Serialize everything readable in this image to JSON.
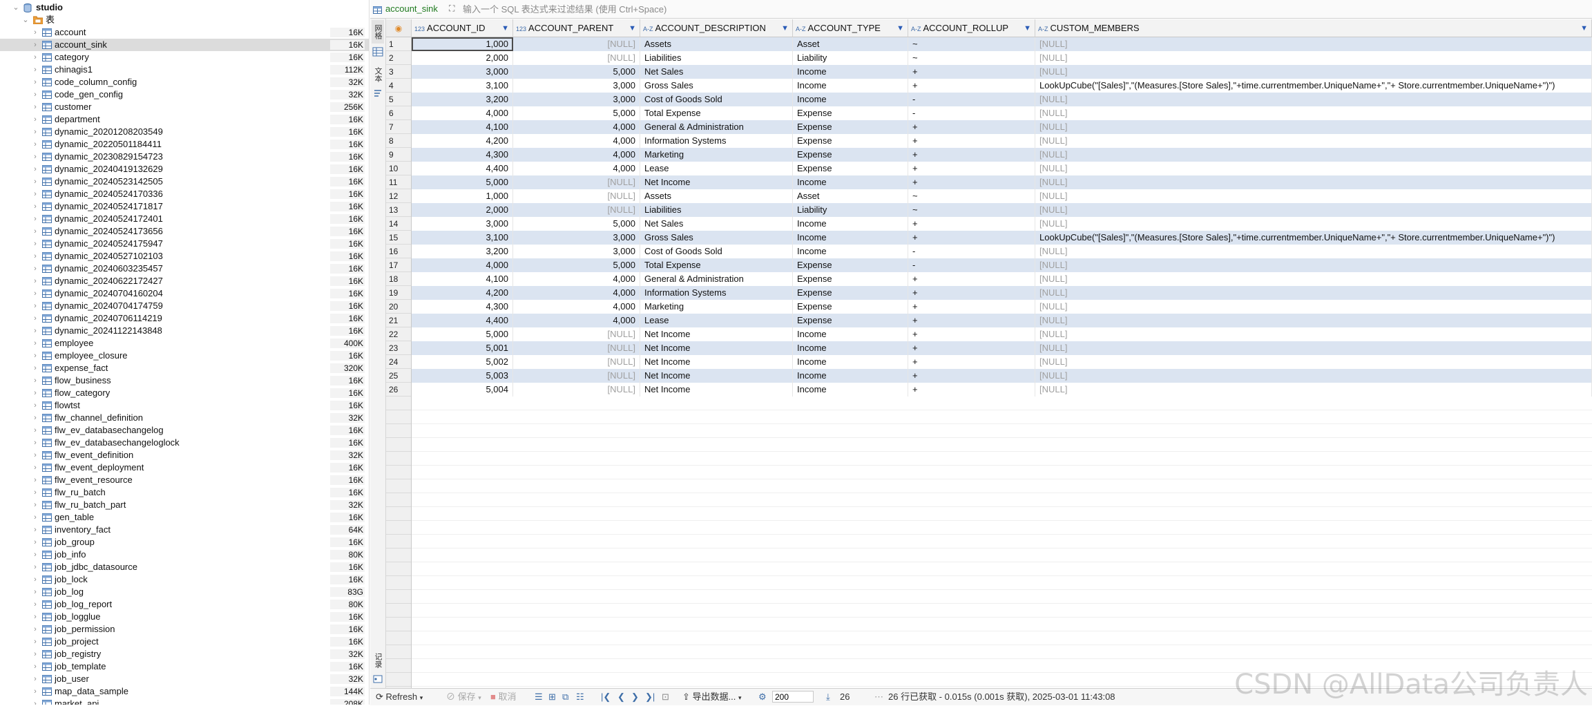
{
  "navigator": {
    "database": "studio",
    "folder": "表",
    "tables": [
      {
        "name": "account",
        "size": "16K"
      },
      {
        "name": "account_sink",
        "size": "16K",
        "selected": true
      },
      {
        "name": "category",
        "size": "16K"
      },
      {
        "name": "chinagis1",
        "size": "112K"
      },
      {
        "name": "code_column_config",
        "size": "32K"
      },
      {
        "name": "code_gen_config",
        "size": "32K"
      },
      {
        "name": "customer",
        "size": "256K"
      },
      {
        "name": "department",
        "size": "16K"
      },
      {
        "name": "dynamic_20201208203549",
        "size": "16K"
      },
      {
        "name": "dynamic_20220501184411",
        "size": "16K"
      },
      {
        "name": "dynamic_20230829154723",
        "size": "16K"
      },
      {
        "name": "dynamic_20240419132629",
        "size": "16K"
      },
      {
        "name": "dynamic_20240523142505",
        "size": "16K"
      },
      {
        "name": "dynamic_20240524170336",
        "size": "16K"
      },
      {
        "name": "dynamic_20240524171817",
        "size": "16K"
      },
      {
        "name": "dynamic_20240524172401",
        "size": "16K"
      },
      {
        "name": "dynamic_20240524173656",
        "size": "16K"
      },
      {
        "name": "dynamic_20240524175947",
        "size": "16K"
      },
      {
        "name": "dynamic_20240527102103",
        "size": "16K"
      },
      {
        "name": "dynamic_20240603235457",
        "size": "16K"
      },
      {
        "name": "dynamic_20240622172427",
        "size": "16K"
      },
      {
        "name": "dynamic_20240704160204",
        "size": "16K"
      },
      {
        "name": "dynamic_20240704174759",
        "size": "16K"
      },
      {
        "name": "dynamic_20240706114219",
        "size": "16K"
      },
      {
        "name": "dynamic_20241122143848",
        "size": "16K"
      },
      {
        "name": "employee",
        "size": "400K"
      },
      {
        "name": "employee_closure",
        "size": "16K"
      },
      {
        "name": "expense_fact",
        "size": "320K"
      },
      {
        "name": "flow_business",
        "size": "16K"
      },
      {
        "name": "flow_category",
        "size": "16K"
      },
      {
        "name": "flowtst",
        "size": "16K"
      },
      {
        "name": "flw_channel_definition",
        "size": "32K"
      },
      {
        "name": "flw_ev_databasechangelog",
        "size": "16K"
      },
      {
        "name": "flw_ev_databasechangeloglock",
        "size": "16K"
      },
      {
        "name": "flw_event_definition",
        "size": "32K"
      },
      {
        "name": "flw_event_deployment",
        "size": "16K"
      },
      {
        "name": "flw_event_resource",
        "size": "16K"
      },
      {
        "name": "flw_ru_batch",
        "size": "16K"
      },
      {
        "name": "flw_ru_batch_part",
        "size": "32K"
      },
      {
        "name": "gen_table",
        "size": "16K"
      },
      {
        "name": "inventory_fact",
        "size": "64K"
      },
      {
        "name": "job_group",
        "size": "16K"
      },
      {
        "name": "job_info",
        "size": "80K"
      },
      {
        "name": "job_jdbc_datasource",
        "size": "16K"
      },
      {
        "name": "job_lock",
        "size": "16K"
      },
      {
        "name": "job_log",
        "size": "83G"
      },
      {
        "name": "job_log_report",
        "size": "80K"
      },
      {
        "name": "job_logglue",
        "size": "16K"
      },
      {
        "name": "job_permission",
        "size": "16K"
      },
      {
        "name": "job_project",
        "size": "16K"
      },
      {
        "name": "job_registry",
        "size": "32K"
      },
      {
        "name": "job_template",
        "size": "16K"
      },
      {
        "name": "job_user",
        "size": "32K"
      },
      {
        "name": "map_data_sample",
        "size": "144K"
      },
      {
        "name": "market_api",
        "size": "208K"
      }
    ]
  },
  "editor": {
    "tab_label": "account_sink",
    "filter_placeholder": "输入一个 SQL 表达式来过滤结果 (使用 Ctrl+Space)",
    "side_tabs": {
      "grid": "网格",
      "text": "文本",
      "record": "记录"
    }
  },
  "grid": {
    "columns": [
      {
        "name": "ACCOUNT_ID",
        "type": "123"
      },
      {
        "name": "ACCOUNT_PARENT",
        "type": "123"
      },
      {
        "name": "ACCOUNT_DESCRIPTION",
        "type": "A-Z"
      },
      {
        "name": "ACCOUNT_TYPE",
        "type": "A-Z"
      },
      {
        "name": "ACCOUNT_ROLLUP",
        "type": "A-Z"
      },
      {
        "name": "CUSTOM_MEMBERS",
        "type": "A-Z"
      }
    ],
    "rows": [
      [
        "1",
        "1,000",
        "[NULL]",
        "Assets",
        "Asset",
        "~",
        "[NULL]"
      ],
      [
        "2",
        "2,000",
        "[NULL]",
        "Liabilities",
        "Liability",
        "~",
        "[NULL]"
      ],
      [
        "3",
        "3,000",
        "5,000",
        "Net Sales",
        "Income",
        "+",
        "[NULL]"
      ],
      [
        "4",
        "3,100",
        "3,000",
        "Gross Sales",
        "Income",
        "+",
        "LookUpCube(\"[Sales]\",\"(Measures.[Store Sales],\"+time.currentmember.UniqueName+\",\"+ Store.currentmember.UniqueName+\")\")"
      ],
      [
        "5",
        "3,200",
        "3,000",
        "Cost of Goods Sold",
        "Income",
        "-",
        "[NULL]"
      ],
      [
        "6",
        "4,000",
        "5,000",
        "Total Expense",
        "Expense",
        "-",
        "[NULL]"
      ],
      [
        "7",
        "4,100",
        "4,000",
        "General & Administration",
        "Expense",
        "+",
        "[NULL]"
      ],
      [
        "8",
        "4,200",
        "4,000",
        "Information Systems",
        "Expense",
        "+",
        "[NULL]"
      ],
      [
        "9",
        "4,300",
        "4,000",
        "Marketing",
        "Expense",
        "+",
        "[NULL]"
      ],
      [
        "10",
        "4,400",
        "4,000",
        "Lease",
        "Expense",
        "+",
        "[NULL]"
      ],
      [
        "11",
        "5,000",
        "[NULL]",
        "Net Income",
        "Income",
        "+",
        "[NULL]"
      ],
      [
        "12",
        "1,000",
        "[NULL]",
        "Assets",
        "Asset",
        "~",
        "[NULL]"
      ],
      [
        "13",
        "2,000",
        "[NULL]",
        "Liabilities",
        "Liability",
        "~",
        "[NULL]"
      ],
      [
        "14",
        "3,000",
        "5,000",
        "Net Sales",
        "Income",
        "+",
        "[NULL]"
      ],
      [
        "15",
        "3,100",
        "3,000",
        "Gross Sales",
        "Income",
        "+",
        "LookUpCube(\"[Sales]\",\"(Measures.[Store Sales],\"+time.currentmember.UniqueName+\",\"+ Store.currentmember.UniqueName+\")\")"
      ],
      [
        "16",
        "3,200",
        "3,000",
        "Cost of Goods Sold",
        "Income",
        "-",
        "[NULL]"
      ],
      [
        "17",
        "4,000",
        "5,000",
        "Total Expense",
        "Expense",
        "-",
        "[NULL]"
      ],
      [
        "18",
        "4,100",
        "4,000",
        "General & Administration",
        "Expense",
        "+",
        "[NULL]"
      ],
      [
        "19",
        "4,200",
        "4,000",
        "Information Systems",
        "Expense",
        "+",
        "[NULL]"
      ],
      [
        "20",
        "4,300",
        "4,000",
        "Marketing",
        "Expense",
        "+",
        "[NULL]"
      ],
      [
        "21",
        "4,400",
        "4,000",
        "Lease",
        "Expense",
        "+",
        "[NULL]"
      ],
      [
        "22",
        "5,000",
        "[NULL]",
        "Net Income",
        "Income",
        "+",
        "[NULL]"
      ],
      [
        "23",
        "5,001",
        "[NULL]",
        "Net Income",
        "Income",
        "+",
        "[NULL]"
      ],
      [
        "24",
        "5,002",
        "[NULL]",
        "Net Income",
        "Income",
        "+",
        "[NULL]"
      ],
      [
        "25",
        "5,003",
        "[NULL]",
        "Net Income",
        "Income",
        "+",
        "[NULL]"
      ],
      [
        "26",
        "5,004",
        "[NULL]",
        "Net Income",
        "Income",
        "+",
        "[NULL]"
      ]
    ]
  },
  "statusbar": {
    "refresh": "Refresh",
    "save": "保存",
    "cancel": "取消",
    "export": "导出数据...",
    "limit": "200",
    "row_count": "26",
    "fetch_info": "26 行已获取 - 0.015s (0.001s 获取), 2025-03-01 11:43:08"
  },
  "watermark": "CSDN @AllData公司负责人",
  "colors": {
    "accent": "#2a5bb6",
    "row_alt": "#dbe4f1",
    "selected_nav": "#dcdcdc",
    "table_tab": "#1f7a1f"
  }
}
